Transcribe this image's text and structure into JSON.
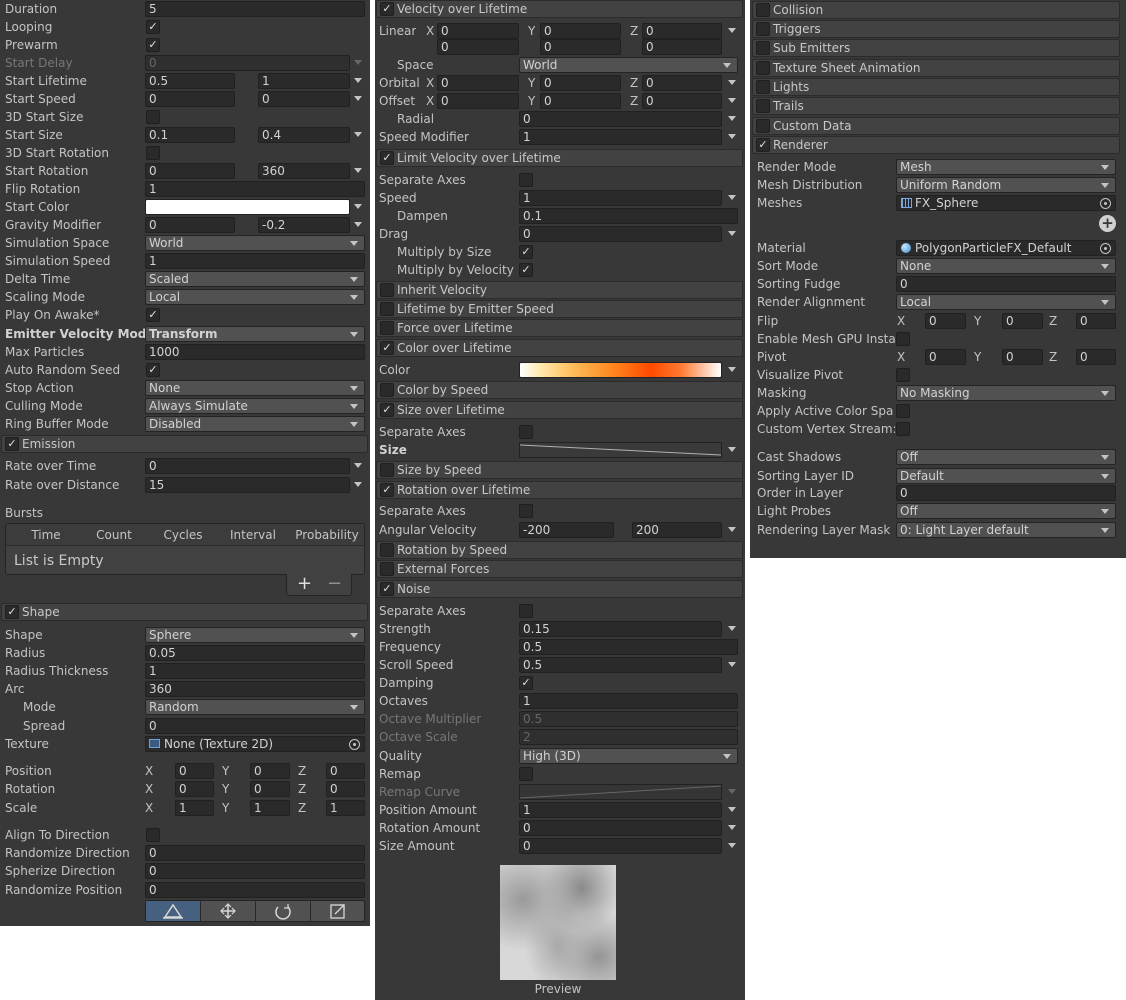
{
  "main": {
    "duration": {
      "label": "Duration",
      "value": "5"
    },
    "looping": {
      "label": "Looping",
      "checked": "✓"
    },
    "prewarm": {
      "label": "Prewarm",
      "checked": "✓"
    },
    "start_delay": {
      "label": "Start Delay",
      "value": "0"
    },
    "start_lifetime": {
      "label": "Start Lifetime",
      "a": "0.5",
      "b": "1"
    },
    "start_speed": {
      "label": "Start Speed",
      "a": "0",
      "b": "0"
    },
    "start_size_3d": {
      "label": "3D Start Size"
    },
    "start_size": {
      "label": "Start Size",
      "a": "0.1",
      "b": "0.4"
    },
    "start_rotation_3d": {
      "label": "3D Start Rotation"
    },
    "start_rotation": {
      "label": "Start Rotation",
      "a": "0",
      "b": "360"
    },
    "flip_rotation": {
      "label": "Flip Rotation",
      "value": "1"
    },
    "start_color": {
      "label": "Start Color",
      "color": "#ffffff"
    },
    "gravity_modifier": {
      "label": "Gravity Modifier",
      "a": "0",
      "b": "-0.2"
    },
    "simulation_space": {
      "label": "Simulation Space",
      "value": "World"
    },
    "simulation_speed": {
      "label": "Simulation Speed",
      "value": "1"
    },
    "delta_time": {
      "label": "Delta Time",
      "value": "Scaled"
    },
    "scaling_mode": {
      "label": "Scaling Mode",
      "value": "Local"
    },
    "play_on_awake": {
      "label": "Play On Awake*",
      "checked": "✓"
    },
    "emitter_velocity_mode": {
      "label": "Emitter Velocity Mode",
      "value": "Transform"
    },
    "max_particles": {
      "label": "Max Particles",
      "value": "1000"
    },
    "auto_random_seed": {
      "label": "Auto Random Seed",
      "checked": "✓"
    },
    "stop_action": {
      "label": "Stop Action",
      "value": "None"
    },
    "culling_mode": {
      "label": "Culling Mode",
      "value": "Always Simulate"
    },
    "ring_buffer_mode": {
      "label": "Ring Buffer Mode",
      "value": "Disabled"
    }
  },
  "emission": {
    "title": "Emission",
    "checked": "✓",
    "rate_over_time": {
      "label": "Rate over Time",
      "value": "0"
    },
    "rate_over_distance": {
      "label": "Rate over Distance",
      "value": "15"
    },
    "bursts_label": "Bursts",
    "columns": [
      "Time",
      "Count",
      "Cycles",
      "Interval",
      "Probability"
    ],
    "empty": "List is Empty",
    "add": "+",
    "remove": "−"
  },
  "shape": {
    "title": "Shape",
    "checked": "✓",
    "shape": {
      "label": "Shape",
      "value": "Sphere"
    },
    "radius": {
      "label": "Radius",
      "value": "0.05"
    },
    "radius_thickness": {
      "label": "Radius Thickness",
      "value": "1"
    },
    "arc": {
      "label": "Arc",
      "value": "360"
    },
    "mode": {
      "label": "Mode",
      "value": "Random"
    },
    "spread": {
      "label": "Spread",
      "value": "0"
    },
    "texture": {
      "label": "Texture",
      "value": "None (Texture 2D)"
    },
    "position": {
      "label": "Position",
      "x": "0",
      "y": "0",
      "z": "0"
    },
    "rotation": {
      "label": "Rotation",
      "x": "0",
      "y": "0",
      "z": "0"
    },
    "scale": {
      "label": "Scale",
      "x": "1",
      "y": "1",
      "z": "1"
    },
    "align_to_direction": {
      "label": "Align To Direction"
    },
    "randomize_direction": {
      "label": "Randomize Direction",
      "value": "0"
    },
    "spherize_direction": {
      "label": "Spherize Direction",
      "value": "0"
    },
    "randomize_position": {
      "label": "Randomize Position",
      "value": "0"
    },
    "axis_x": "X",
    "axis_y": "Y",
    "axis_z": "Z"
  },
  "velocity": {
    "title": "Velocity over Lifetime",
    "checked": "✓",
    "linear_label": "Linear",
    "linear": {
      "x": "0",
      "y": "0",
      "z": "0",
      "x2": "0",
      "y2": "0",
      "z2": "0"
    },
    "space": {
      "label": "Space",
      "value": "World"
    },
    "orbital": {
      "label": "Orbital",
      "x": "0",
      "y": "0",
      "z": "0"
    },
    "offset": {
      "label": "Offset",
      "x": "0",
      "y": "0",
      "z": "0"
    },
    "radial": {
      "label": "Radial",
      "value": "0"
    },
    "speed_modifier": {
      "label": "Speed Modifier",
      "value": "1"
    }
  },
  "limit_velocity": {
    "title": "Limit Velocity over Lifetime",
    "checked": "✓",
    "separate_axes": {
      "label": "Separate Axes"
    },
    "speed": {
      "label": "Speed",
      "value": "1"
    },
    "dampen": {
      "label": "Dampen",
      "value": "0.1"
    },
    "drag": {
      "label": "Drag",
      "value": "0"
    },
    "multiply_by_size": {
      "label": "Multiply by Size",
      "checked": "✓"
    },
    "multiply_by_velocity": {
      "label": "Multiply by Velocity",
      "checked": "✓"
    }
  },
  "modules_mid": {
    "inherit_velocity": "Inherit Velocity",
    "lifetime_by_emitter_speed": "Lifetime by Emitter Speed",
    "force_over_lifetime": "Force over Lifetime",
    "color_over_lifetime": "Color over Lifetime",
    "color_label": "Color",
    "color_by_speed": "Color by Speed",
    "size_over_lifetime": "Size over Lifetime",
    "separate_axes": "Separate Axes",
    "size_label": "Size",
    "size_by_speed": "Size by Speed",
    "rotation_over_lifetime": "Rotation over Lifetime",
    "angular_velocity": {
      "label": "Angular Velocity",
      "a": "-200",
      "b": "200"
    },
    "rotation_by_speed": "Rotation by Speed",
    "external_forces": "External Forces",
    "checked": "✓"
  },
  "noise": {
    "title": "Noise",
    "checked": "✓",
    "separate_axes": {
      "label": "Separate Axes"
    },
    "strength": {
      "label": "Strength",
      "value": "0.15"
    },
    "frequency": {
      "label": "Frequency",
      "value": "0.5"
    },
    "scroll_speed": {
      "label": "Scroll Speed",
      "value": "0.5"
    },
    "damping": {
      "label": "Damping",
      "checked": "✓"
    },
    "octaves": {
      "label": "Octaves",
      "value": "1"
    },
    "octave_multiplier": {
      "label": "Octave Multiplier",
      "value": "0.5"
    },
    "octave_scale": {
      "label": "Octave Scale",
      "value": "2"
    },
    "quality": {
      "label": "Quality",
      "value": "High (3D)"
    },
    "remap": {
      "label": "Remap"
    },
    "remap_curve": {
      "label": "Remap Curve"
    },
    "position_amount": {
      "label": "Position Amount",
      "value": "1"
    },
    "rotation_amount": {
      "label": "Rotation Amount",
      "value": "0"
    },
    "size_amount": {
      "label": "Size Amount",
      "value": "0"
    },
    "preview_label": "Preview"
  },
  "modules_right": {
    "collision": "Collision",
    "triggers": "Triggers",
    "sub_emitters": "Sub Emitters",
    "texture_sheet_animation": "Texture Sheet Animation",
    "lights": "Lights",
    "trails": "Trails",
    "custom_data": "Custom Data",
    "renderer": "Renderer",
    "checked": "✓"
  },
  "renderer": {
    "render_mode": {
      "label": "Render Mode",
      "value": "Mesh"
    },
    "mesh_distribution": {
      "label": "Mesh Distribution",
      "value": "Uniform Random"
    },
    "meshes": {
      "label": "Meshes",
      "value": "FX_Sphere"
    },
    "add": "+",
    "material": {
      "label": "Material",
      "value": "PolygonParticleFX_Default"
    },
    "sort_mode": {
      "label": "Sort Mode",
      "value": "None"
    },
    "sorting_fudge": {
      "label": "Sorting Fudge",
      "value": "0"
    },
    "render_alignment": {
      "label": "Render Alignment",
      "value": "Local"
    },
    "flip": {
      "label": "Flip",
      "x": "0",
      "y": "0",
      "z": "0"
    },
    "enable_mesh_gpu": {
      "label": "Enable Mesh GPU Insta"
    },
    "pivot": {
      "label": "Pivot",
      "x": "0",
      "y": "0",
      "z": "0"
    },
    "visualize_pivot": {
      "label": "Visualize Pivot"
    },
    "masking": {
      "label": "Masking",
      "value": "No Masking"
    },
    "apply_active_color_space": {
      "label": "Apply Active Color Spa"
    },
    "custom_vertex_streams": {
      "label": "Custom Vertex Stream:"
    },
    "cast_shadows": {
      "label": "Cast Shadows",
      "value": "Off"
    },
    "sorting_layer_id": {
      "label": "Sorting Layer ID",
      "value": "Default"
    },
    "order_in_layer": {
      "label": "Order in Layer",
      "value": "0"
    },
    "light_probes": {
      "label": "Light Probes",
      "value": "Off"
    },
    "rendering_layer_mask": {
      "label": "Rendering Layer Mask",
      "value": "0: Light Layer default"
    }
  }
}
